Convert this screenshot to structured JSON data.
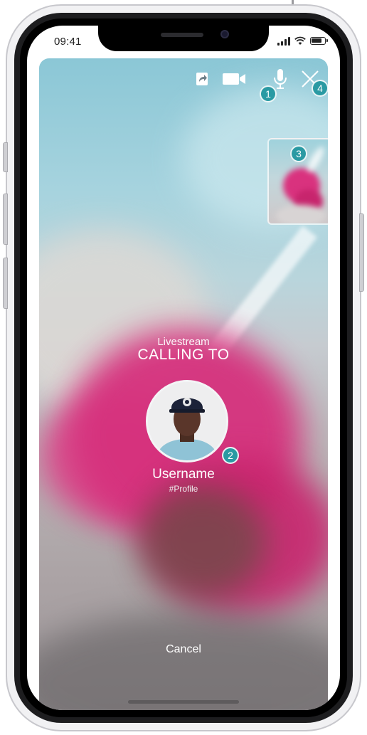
{
  "status_bar": {
    "time": "09:41",
    "battery_level": 0.8
  },
  "controls": {
    "share_icon": "share-icon",
    "video_icon": "video-camera-icon",
    "mic_icon": "microphone-icon",
    "close_icon": "close-icon"
  },
  "markers": [
    "1",
    "2",
    "3",
    "4"
  ],
  "call": {
    "type_label": "Livestream",
    "heading": "CALLING TO",
    "username": "Username",
    "profile_tag": "#Profile",
    "cancel_label": "Cancel"
  },
  "colors": {
    "accent": "#2a9aa3",
    "hair": "#d6317d",
    "sky": "#8bc7d6"
  }
}
